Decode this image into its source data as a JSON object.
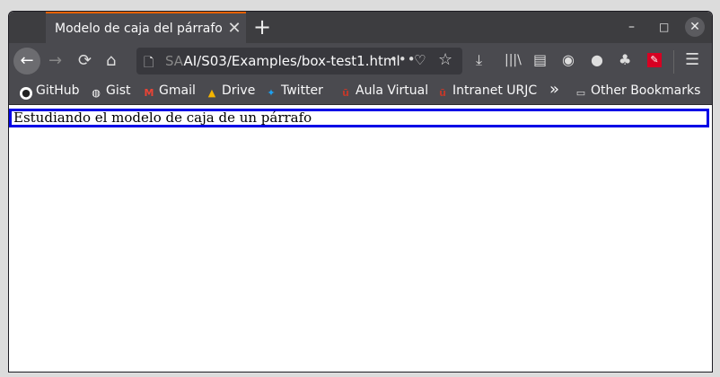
{
  "tab": {
    "title": "Modelo de caja del párrafo",
    "close": "✕"
  },
  "window_controls": {
    "minimize": "–",
    "maximize": "□",
    "close": "✕"
  },
  "navigation": {
    "back": "←",
    "forward": "→",
    "reload": "⟳",
    "home": "⌂"
  },
  "url": {
    "dim": "SA",
    "text": "AI/S03/Examples/box-test1.html"
  },
  "bookmarks": [
    {
      "label": "GitHub",
      "icon": "github-icon"
    },
    {
      "label": "Gist",
      "icon": "globe-icon"
    },
    {
      "label": "Gmail",
      "icon": "gmail-icon"
    },
    {
      "label": "Drive",
      "icon": "drive-icon"
    },
    {
      "label": "Twitter",
      "icon": "twitter-icon"
    },
    {
      "label": "Aula Virtual",
      "icon": "urjc-icon"
    },
    {
      "label": "Intranet URJC",
      "icon": "urjc-icon"
    }
  ],
  "other_bookmarks": "Other Bookmarks",
  "overflow": "»",
  "content": {
    "paragraph": "Estudiando el modelo de caja de un párrafo"
  },
  "colors": {
    "paragraph_border": "#0000e6",
    "tab_accent": "#e66000"
  }
}
